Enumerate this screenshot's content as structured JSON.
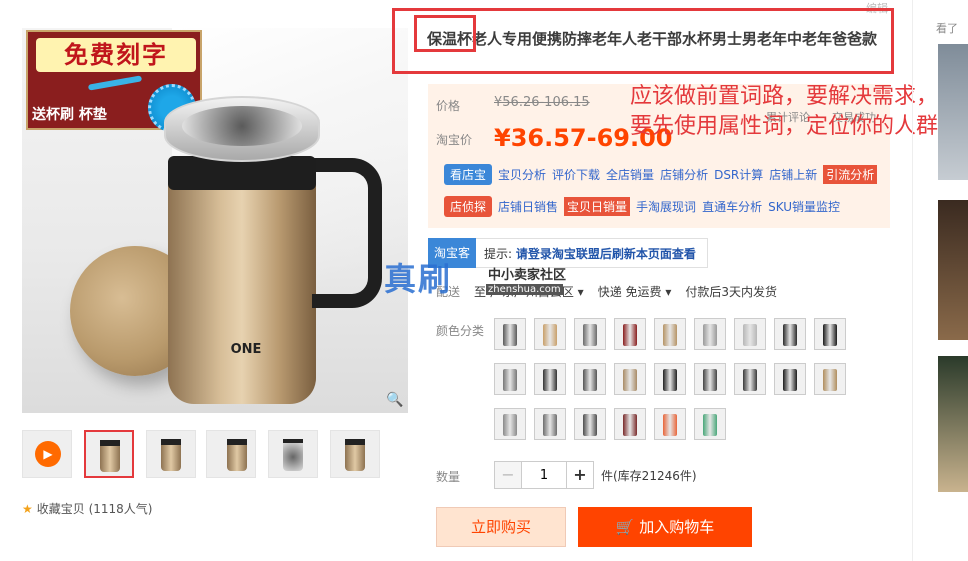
{
  "product": {
    "title": "保温杯老人专用便携防摔老年人老干部水杯男士男老年中老年爸爸款",
    "engrave_badge": {
      "title": "免费刻字",
      "subtitle": "送杯刷 杯垫"
    },
    "cup_logo": "ONE",
    "collect": "收藏宝贝 (1118人气)"
  },
  "top_link": "编辑",
  "price": {
    "orig_label": "价格",
    "orig_value": "¥56.26-106.15",
    "tb_label": "淘宝价",
    "tb_value": "¥36.57-69.00",
    "review_a": "累计评论",
    "review_b": "交易成功"
  },
  "annotation": "应该做前置词路，要解决需求，你要先使用属性词，定位你的人群",
  "tools": {
    "row1": {
      "badge": "看店宝",
      "items": [
        "宝贝分析",
        "评价下载",
        "全店销量",
        "店铺分析",
        "DSR计算",
        "店铺上新"
      ],
      "highlight": "引流分析"
    },
    "row2": {
      "badge": "店侦探",
      "items_before": [
        "店铺日销售"
      ],
      "highlight": "宝贝日销量",
      "items_after": [
        "手淘展现词",
        "直通车分析",
        "SKU销量监控"
      ]
    }
  },
  "tbk": {
    "badge": "淘宝客",
    "prefix": "提示:",
    "text": "请登录淘宝联盟后刷新本页面查看"
  },
  "watermark": {
    "big": "真刷",
    "small": "中小卖家社区",
    "url": "zhenshua.com"
  },
  "shipping": {
    "label": "配送",
    "from": "至 广东广州白云区",
    "express": "快递 免运费",
    "pay": "付款后3天内发货"
  },
  "color_label": "颜色分类",
  "swatches": [
    "#5a5a5a",
    "#c9a06a",
    "#6b6b6b",
    "#8a1f1f",
    "#b69466",
    "#9a9a9a",
    "#b7b7b7",
    "#2a2a2a",
    "#1a1a1a",
    "#777777",
    "#333333",
    "#555555",
    "#a98c66",
    "#222222",
    "#444444",
    "#3a3a3a",
    "#1c1c1c",
    "#b08e5e",
    "#8a8a8a",
    "#6e6e6e",
    "#4e4e4e",
    "#7a2b2b",
    "#e8663a",
    "#4aa87a"
  ],
  "quantity": {
    "label": "数量",
    "value": "1",
    "minus": "−",
    "plus": "+",
    "stock": "件(库存21246件)"
  },
  "buttons": {
    "buy": "立即购买",
    "cart": "加入购物车"
  },
  "right_col": {
    "heading": "看了"
  },
  "colors": {
    "accent": "#ff4400",
    "annotation": "#e4393c",
    "tool_blue": "#3b87d8"
  }
}
